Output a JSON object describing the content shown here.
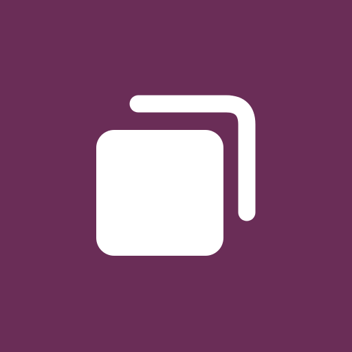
{
  "app_icon": {
    "icon": "copy-icon",
    "background_color": "#6a2d57",
    "foreground_color": "#ffffff"
  }
}
